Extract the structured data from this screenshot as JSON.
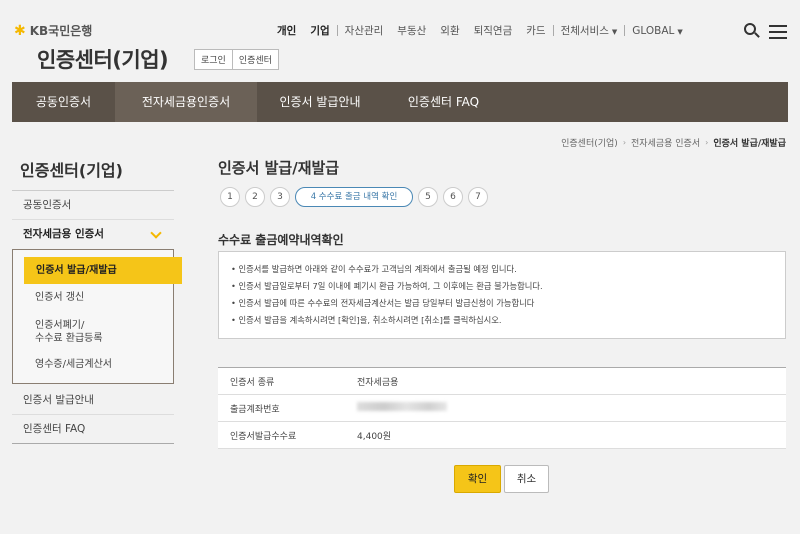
{
  "header": {
    "logo_text": "KB국민은행",
    "title": "인증센터(기업)",
    "login_links": [
      "로그인",
      "인증센터"
    ]
  },
  "topnav": {
    "items": [
      "개인",
      "기업",
      "자산관리",
      "부동산",
      "외환",
      "퇴직연금",
      "카드",
      "전체서비스",
      "GLOBAL"
    ]
  },
  "mainnav": {
    "tabs": [
      "공동인증서",
      "전자세금용인증서",
      "인증서 발급안내",
      "인증센터 FAQ"
    ],
    "active_index": 1
  },
  "breadcrumb": [
    "인증센터(기업)",
    "전자세금용 인증서",
    "인증서 발급/재발급"
  ],
  "sidebar": {
    "title": "인증센터(기업)",
    "items": [
      "공동인증서",
      "전자세금용 인증서",
      "인증서 발급안내",
      "인증센터 FAQ"
    ],
    "submenu": [
      "인증서 발급/재발급",
      "인증서 갱신",
      "인증서폐기/",
      "수수료 환급등록",
      "영수증/세금계산서"
    ]
  },
  "content": {
    "title": "인증서 발급/재발급",
    "steps": [
      "1",
      "2",
      "3",
      "4 수수료 출금 내역 확인",
      "5",
      "6",
      "7"
    ],
    "current_step": 4,
    "section_title": "수수료 출금예약내역확인",
    "notices": [
      "• 인증서를 발급하면 아래와 같이 수수료가 고객님의 계좌에서 출금될 예정 입니다.",
      "• 인증서 발급일로부터 7일 이내에 폐기시 환급 가능하여, 그 이후에는 환급 불가능합니다.",
      "• 인증서 발급에 따른 수수료의 전자세금계산서는 발급 당일부터 발급신청이 가능합니다",
      "• 인증서 발급을 계속하시려면 [확인]을, 취소하시려면 [취소]를 클릭하십시오."
    ],
    "table": [
      {
        "label": "인증서 종류",
        "value": "전자세금용"
      },
      {
        "label": "출금계좌번호",
        "value": ""
      },
      {
        "label": "인증서발급수수료",
        "value": "4,400원"
      }
    ],
    "confirm_label": "확인",
    "cancel_label": "취소"
  },
  "colors": {
    "accent": "#f5c518",
    "nav_bg": "#5a5148",
    "step_border": "#4a88b5"
  }
}
